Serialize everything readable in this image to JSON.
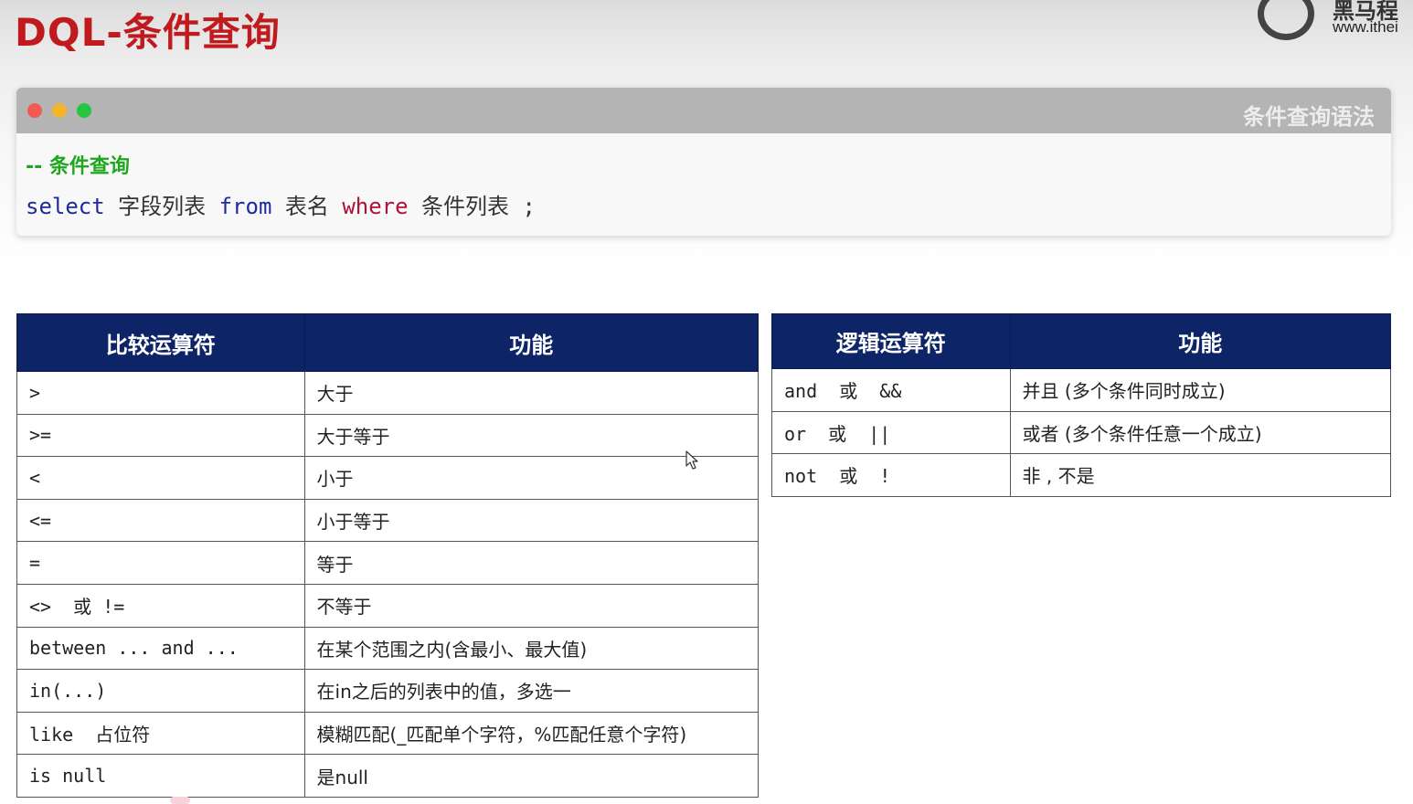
{
  "slide": {
    "title": "DQL-条件查询",
    "logo": {
      "name": "黑马程",
      "url": "www.ithei"
    }
  },
  "code_panel": {
    "title": "条件查询语法",
    "comment": "-- 条件查询",
    "tokens": {
      "select": "select",
      "fields": "字段列表",
      "from": "from",
      "table": "表名",
      "where": "where",
      "conditions": "条件列表",
      "end": ";"
    }
  },
  "comparison_table": {
    "headers": [
      "比较运算符",
      "功能"
    ],
    "rows": [
      [
        ">",
        "大于"
      ],
      [
        ">=",
        "大于等于"
      ],
      [
        "<",
        "小于"
      ],
      [
        "<=",
        "小于等于"
      ],
      [
        "=",
        "等于"
      ],
      [
        "<>  或 !=",
        "不等于"
      ],
      [
        "between ... and ...",
        "在某个范围之内(含最小、最大值)"
      ],
      [
        "in(...)",
        "在in之后的列表中的值，多选一"
      ],
      [
        "like  占位符",
        "模糊匹配(_匹配单个字符，%匹配任意个字符)"
      ],
      [
        "is null",
        "是null"
      ]
    ]
  },
  "logic_table": {
    "headers": [
      "逻辑运算符",
      "功能"
    ],
    "rows": [
      [
        "and  或  &&",
        "并且 (多个条件同时成立)"
      ],
      [
        "or  或  ||",
        "或者 (多个条件任意一个成立)"
      ],
      [
        "not  或  !",
        "非 , 不是"
      ]
    ]
  },
  "colors": {
    "title": "#c0191e",
    "table_header": "#0d2566",
    "keyword_blue": "#1d2a9c",
    "keyword_red": "#b0103a",
    "comment": "#1ea61e"
  }
}
